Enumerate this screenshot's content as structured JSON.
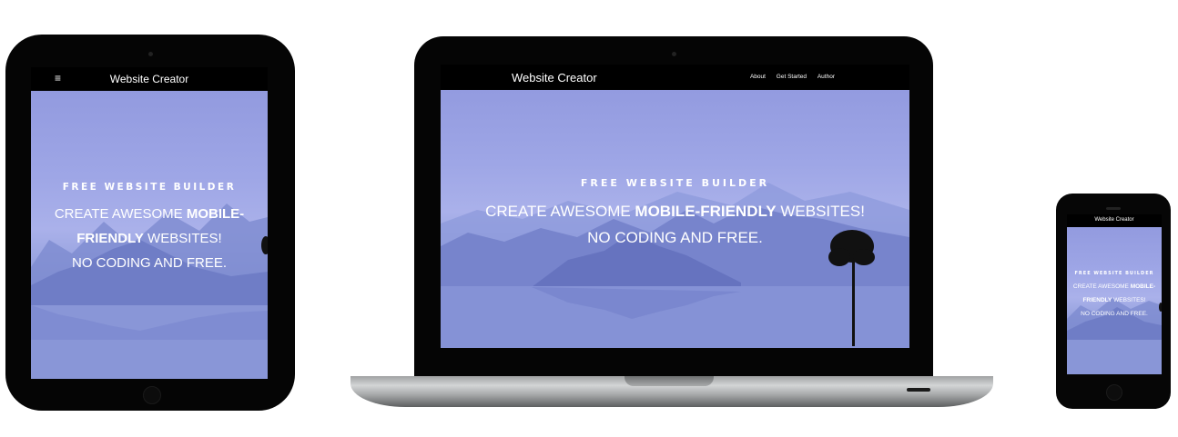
{
  "site": {
    "brand": "Website Creator",
    "menu_glyph": "≡",
    "nav_links": [
      "About",
      "Get Started",
      "Author"
    ],
    "kicker": "FREE WEBSITE BUILDER",
    "headline_pre": "CREATE AWESOME ",
    "headline_bold": "MOBILE-FRIENDLY",
    "headline_post": " WEBSITES!",
    "headline_line2": "NO CODING AND FREE."
  },
  "colors": {
    "device_frame": "#050505",
    "nav_bg": "#000000",
    "sky_top": "#8f97dd",
    "mountain": "#6f7dc6"
  },
  "icons": {
    "menu": "hamburger-icon",
    "camera": "camera-icon",
    "home_button": "home-button-icon"
  }
}
